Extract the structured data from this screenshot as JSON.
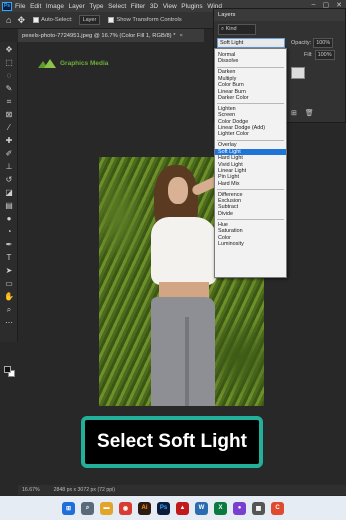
{
  "menu": {
    "logo": "Ps",
    "items": [
      "File",
      "Edit",
      "Image",
      "Layer",
      "Type",
      "Select",
      "Filter",
      "3D",
      "View",
      "Plugins",
      "Wind"
    ]
  },
  "options_bar": {
    "auto_select_label": "Auto-Select:",
    "auto_select_value": "Layer",
    "transform_label": "Show Transform Controls"
  },
  "document_tab": {
    "title": "pexels-photo-7724951.jpeg @ 16.7% (Color Fill 1, RGB/8) *"
  },
  "watermark": {
    "text": "Graphics Media"
  },
  "layers_panel": {
    "title": "Layers",
    "kind_label": "Kind",
    "blend_mode": "Soft Light",
    "opacity_label": "Opacity:",
    "opacity_value": "100%",
    "fill_label": "Fill:",
    "fill_value": "100%"
  },
  "blend_modes": [
    {
      "label": "Normal",
      "group": 1
    },
    {
      "label": "Dissolve",
      "group": 1
    },
    {
      "label": "Darken",
      "group": 2
    },
    {
      "label": "Multiply",
      "group": 2
    },
    {
      "label": "Color Burn",
      "group": 2
    },
    {
      "label": "Linear Burn",
      "group": 2
    },
    {
      "label": "Darker Color",
      "group": 2
    },
    {
      "label": "Lighten",
      "group": 3
    },
    {
      "label": "Screen",
      "group": 3
    },
    {
      "label": "Color Dodge",
      "group": 3
    },
    {
      "label": "Linear Dodge (Add)",
      "group": 3
    },
    {
      "label": "Lighter Color",
      "group": 3
    },
    {
      "label": "Overlay",
      "group": 4
    },
    {
      "label": "Soft Light",
      "group": 4,
      "selected": true
    },
    {
      "label": "Hard Light",
      "group": 4
    },
    {
      "label": "Vivid Light",
      "group": 4
    },
    {
      "label": "Linear Light",
      "group": 4
    },
    {
      "label": "Pin Light",
      "group": 4
    },
    {
      "label": "Hard Mix",
      "group": 4
    },
    {
      "label": "Difference",
      "group": 5
    },
    {
      "label": "Exclusion",
      "group": 5
    },
    {
      "label": "Subtract",
      "group": 5
    },
    {
      "label": "Divide",
      "group": 5
    },
    {
      "label": "Hue",
      "group": 6
    },
    {
      "label": "Saturation",
      "group": 6
    },
    {
      "label": "Color",
      "group": 6
    },
    {
      "label": "Luminosity",
      "group": 6
    }
  ],
  "caption": {
    "text": "Select Soft Light"
  },
  "status_bar": {
    "zoom": "16.67%",
    "doc_size": "2848 px x 3072 px (72 ppi)"
  },
  "colors": {
    "accent_selected": "#1f74d8",
    "caption_border": "#23b09a",
    "watermark_green": "#6fae3b"
  }
}
